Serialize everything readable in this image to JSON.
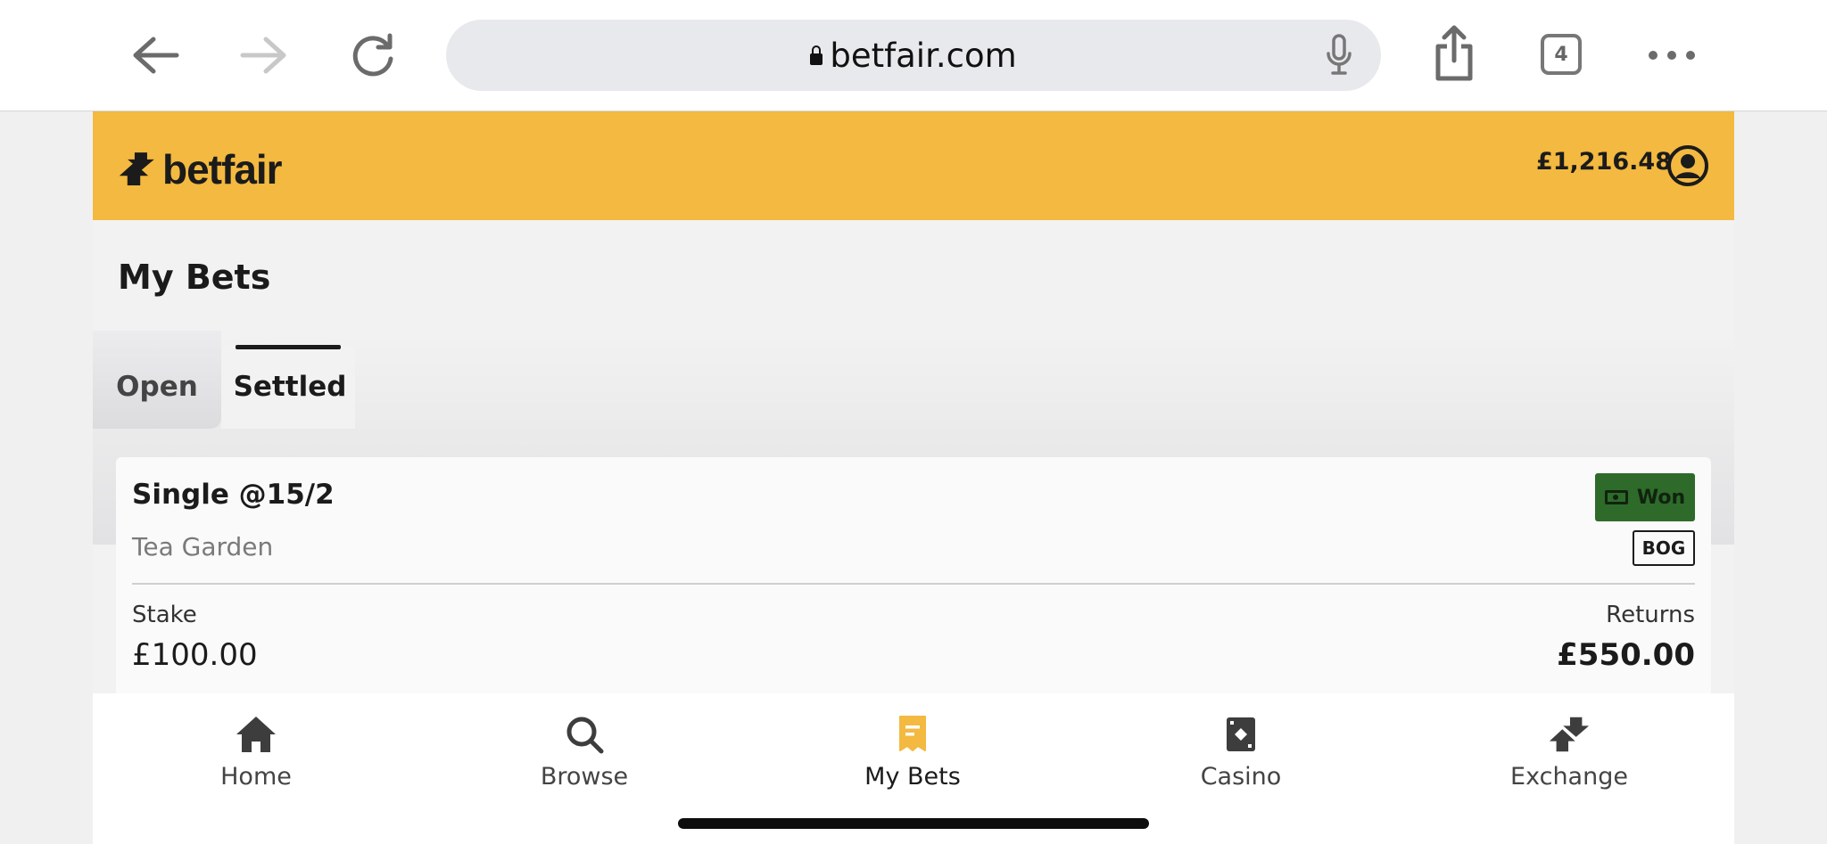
{
  "browser": {
    "url": "betfair.com",
    "tab_count": "4",
    "icons": [
      "back-arrow-icon",
      "forward-arrow-icon",
      "reload-icon",
      "lock-icon",
      "microphone-icon",
      "share-icon",
      "tabs-icon",
      "more-icon"
    ]
  },
  "header": {
    "logo_text": "betfair",
    "balance": "£1,216.48",
    "brand_color": "#f3b940"
  },
  "page": {
    "title": "My Bets"
  },
  "tabs": [
    {
      "label": "Open",
      "active": false
    },
    {
      "label": "Settled",
      "active": true
    }
  ],
  "bet": {
    "type": "Single @15/2",
    "selection": "Tea Garden",
    "status": "Won",
    "status_color": "#2e6a2a",
    "tag": "BOG",
    "stake_label": "Stake",
    "stake": "£100.00",
    "returns_label": "Returns",
    "returns": "£550.00"
  },
  "bottom_nav": [
    {
      "label": "Home",
      "icon": "home-icon",
      "active": false
    },
    {
      "label": "Browse",
      "icon": "search-icon",
      "active": false
    },
    {
      "label": "My Bets",
      "icon": "bet-slip-icon",
      "active": true
    },
    {
      "label": "Casino",
      "icon": "playing-card-icon",
      "active": false
    },
    {
      "label": "Exchange",
      "icon": "exchange-arrows-icon",
      "active": false
    }
  ]
}
